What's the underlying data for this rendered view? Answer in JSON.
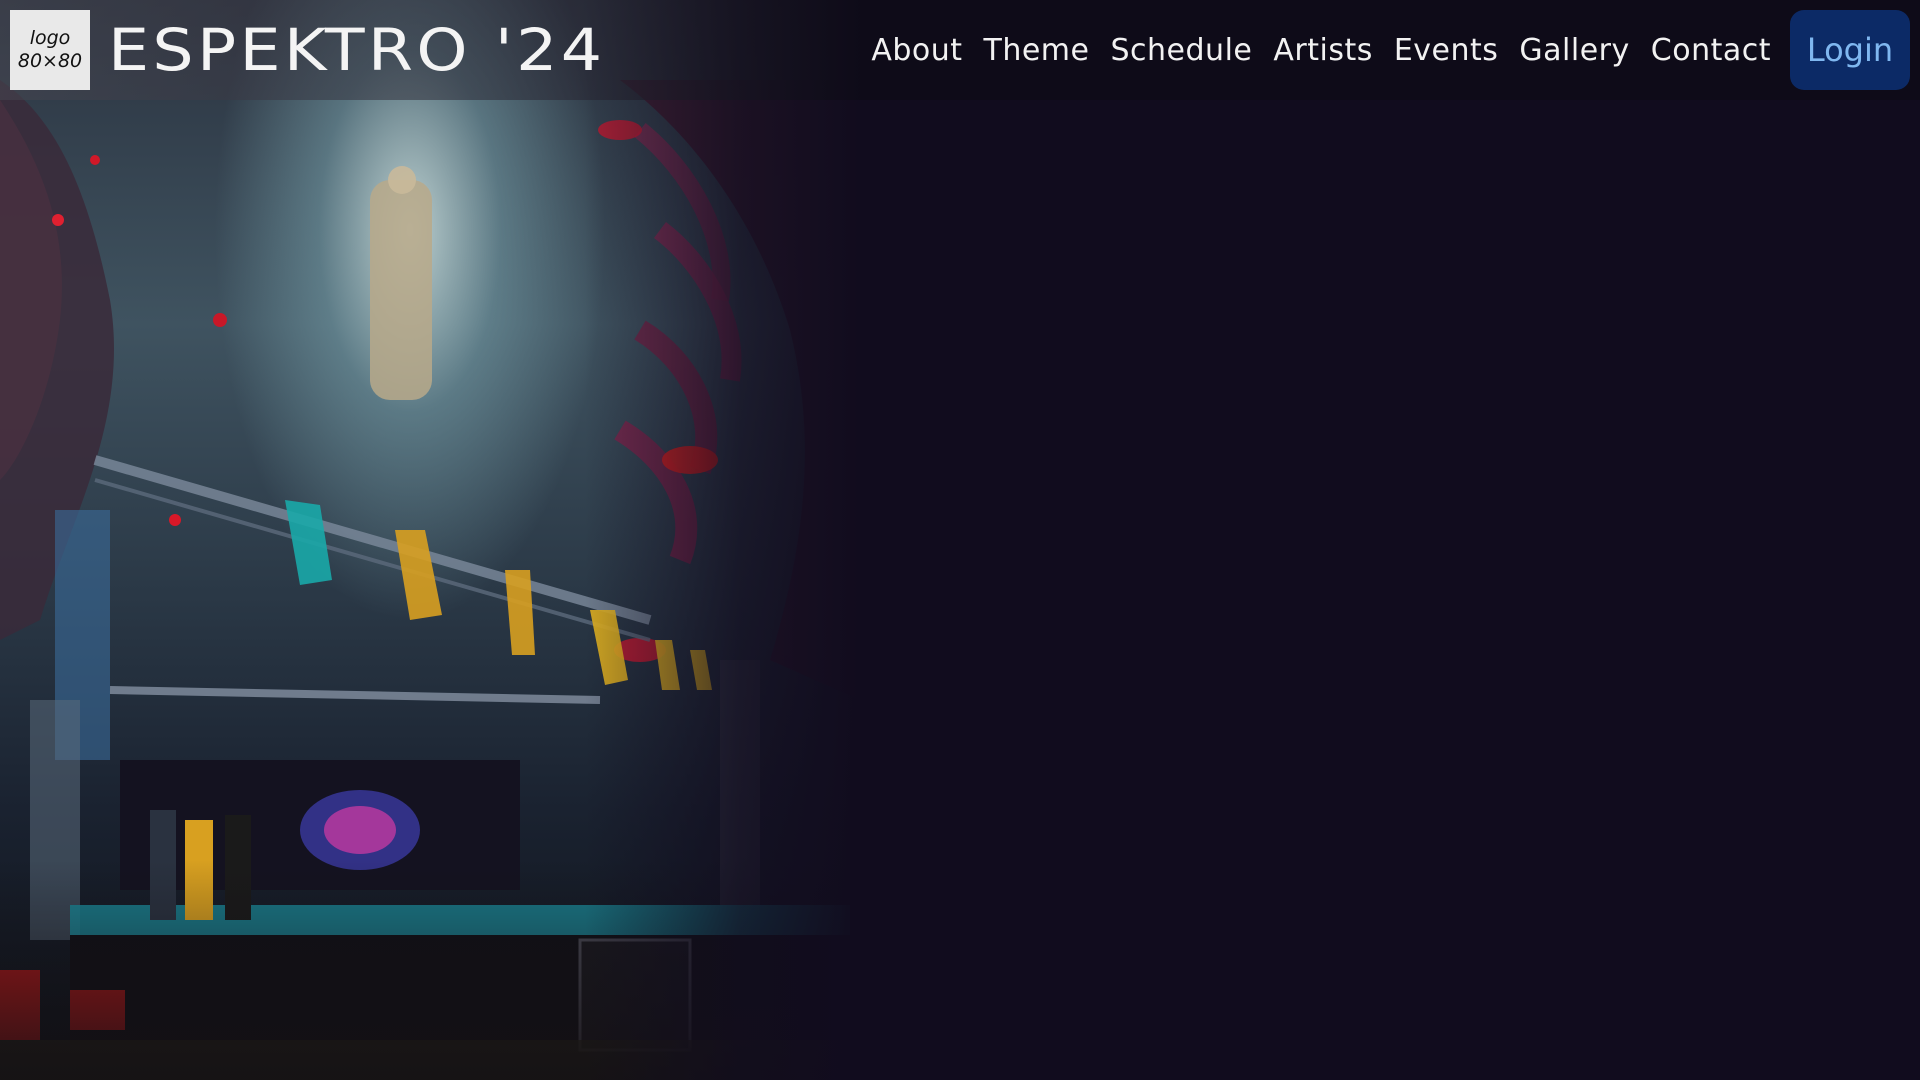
{
  "logo": {
    "line1": "logo",
    "line2": "80×80"
  },
  "header": {
    "title": "ESPEKTRO '24"
  },
  "nav": {
    "items": [
      "About",
      "Theme",
      "Schedule",
      "Artists",
      "Events",
      "Gallery",
      "Contact"
    ],
    "login_label": "Login"
  },
  "colors": {
    "page_background": "#110c1e",
    "login_background": "#0c2a66",
    "login_text": "#7fb7f0"
  }
}
